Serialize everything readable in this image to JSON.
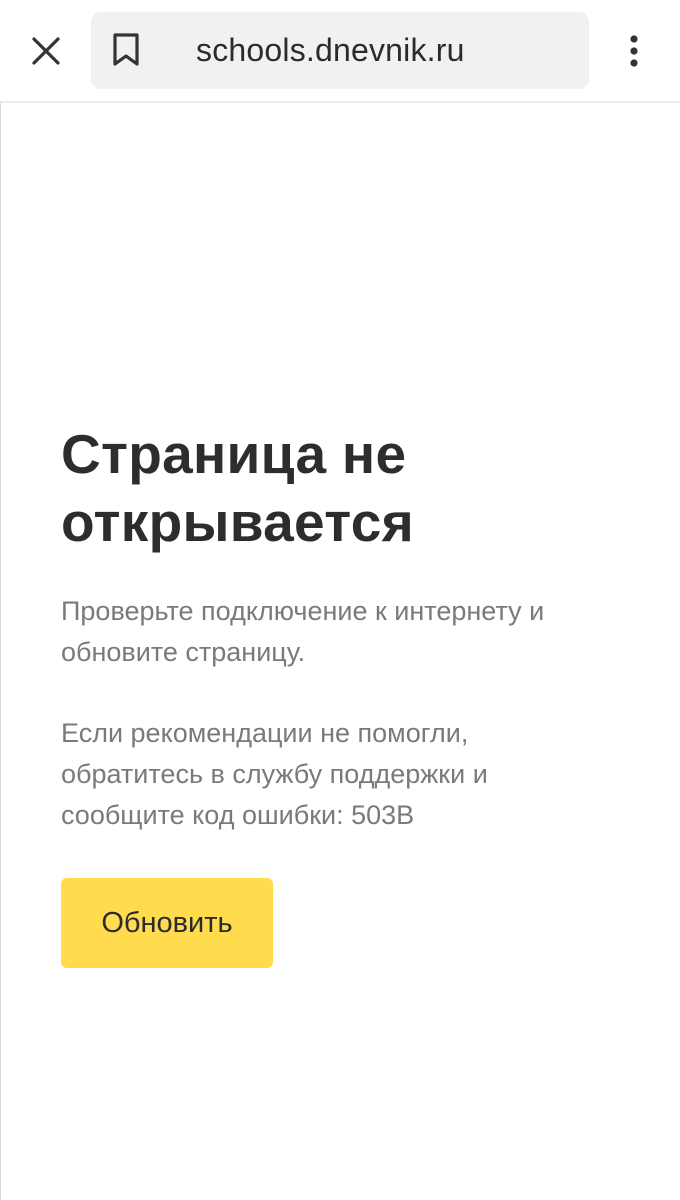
{
  "browser": {
    "url": "schools.dnevnik.ru",
    "close_icon": "close-icon",
    "bookmark_icon": "bookmark-icon",
    "menu_icon": "more-vertical-icon"
  },
  "error_page": {
    "title_line1": "Страница не",
    "title_line2": "открывается",
    "paragraph1_line1": "Проверьте подключение к интернету и",
    "paragraph1_line2": "обновите страницу.",
    "paragraph2_line1": "Если рекомендации не помогли,",
    "paragraph2_line2": "обратитесь в службу поддержки и",
    "paragraph2_line3": "сообщите код ошибки: 503B",
    "refresh_label": "Обновить"
  },
  "colors": {
    "accent": "#ffdb4d",
    "title": "#2d2d2d",
    "body_text": "#7a7a7a",
    "urlbar_bg": "#f1f1f1"
  }
}
